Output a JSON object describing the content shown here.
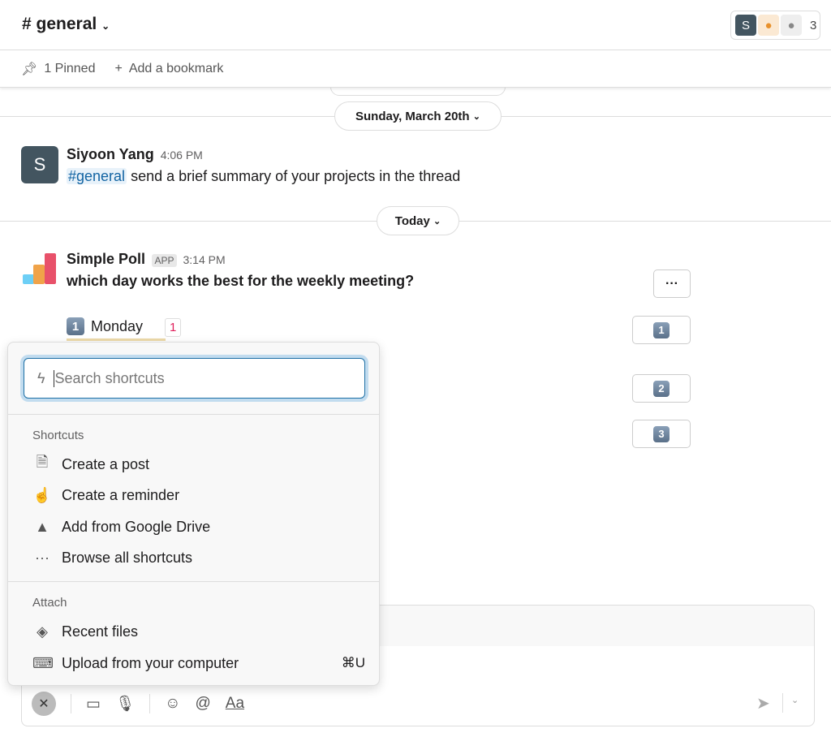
{
  "header": {
    "channel": "# general",
    "member_count": "3",
    "avatar_initial": "S"
  },
  "bookmarks": {
    "pinned": "1 Pinned",
    "add": "Add a bookmark"
  },
  "dividers": {
    "date1": "Sunday, March 20th",
    "today": "Today"
  },
  "messages": [
    {
      "author": "Siyoon Yang",
      "avatar": "S",
      "time": "4:06 PM",
      "mention": "#general",
      "text": "send a brief summary of your projects in the thread"
    },
    {
      "author": "Simple Poll",
      "badge": "APP",
      "time": "3:14 PM",
      "text": "which day works the best for the weekly meeting?",
      "options": [
        {
          "key": "1",
          "label": "Monday",
          "votes": "1"
        }
      ],
      "vote_buttons": [
        "1",
        "2",
        "3"
      ],
      "more": "···"
    }
  ],
  "popup": {
    "search_placeholder": "Search shortcuts",
    "shortcuts_header": "Shortcuts",
    "shortcuts": [
      {
        "icon": "document-icon",
        "label": "Create a post"
      },
      {
        "icon": "hand-icon",
        "label": "Create a reminder"
      },
      {
        "icon": "google-drive-icon",
        "label": "Add from Google Drive"
      },
      {
        "icon": "more-icon",
        "label": "Browse all shortcuts"
      }
    ],
    "attach_header": "Attach",
    "attach": [
      {
        "icon": "layers-icon",
        "label": "Recent files"
      },
      {
        "icon": "laptop-icon",
        "label": "Upload from your computer",
        "shortcut": "⌘U"
      }
    ]
  },
  "composer": {
    "format_label": "Aa"
  },
  "colors": {
    "accent": "#1d6fa5",
    "mention_bg": "#e8f2fa",
    "mention_fg": "#1264a3",
    "vote_count": "#e01e5a"
  }
}
